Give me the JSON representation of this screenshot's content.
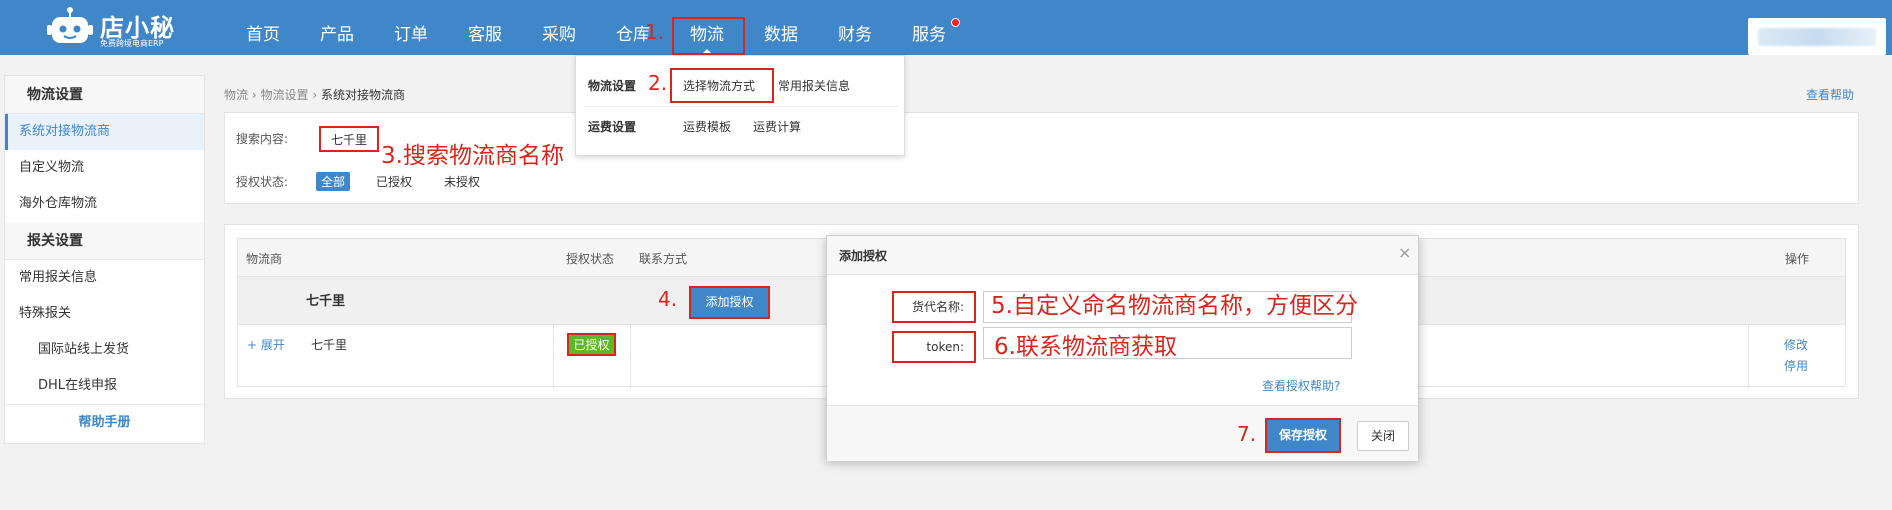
{
  "app": {
    "brand": "店小秘",
    "tagline": "免费跨境电商ERP"
  },
  "nav": {
    "items": [
      {
        "label": "首页"
      },
      {
        "label": "产品"
      },
      {
        "label": "订单"
      },
      {
        "label": "客服"
      },
      {
        "label": "采购"
      },
      {
        "label": "仓库"
      },
      {
        "label": "物流"
      },
      {
        "label": "数据"
      },
      {
        "label": "财务"
      },
      {
        "label": "服务"
      }
    ],
    "active_index": 6
  },
  "dropdown": {
    "group1": {
      "title": "物流设置",
      "links": [
        "选择物流方式",
        "常用报关信息"
      ]
    },
    "group2": {
      "title": "运费设置",
      "links": [
        "运费模板",
        "运费计算"
      ]
    }
  },
  "sidebar": {
    "group1": "物流设置",
    "items1": [
      "系统对接物流商",
      "自定义物流",
      "海外仓库物流"
    ],
    "group2": "报关设置",
    "items2": [
      "常用报关信息",
      "特殊报关"
    ],
    "subitems": [
      "国际站线上发货",
      "DHL在线申报"
    ],
    "help": "帮助手册"
  },
  "breadcrumb": {
    "a": "物流",
    "sep": "›",
    "b": "物流设置",
    "c": "系统对接物流商"
  },
  "help_link": "查看帮助",
  "search": {
    "label": "搜索内容:",
    "value": "七千里",
    "status_label": "授权状态:",
    "filters": [
      "全部",
      "已授权",
      "未授权"
    ]
  },
  "table": {
    "headers": [
      "物流商",
      "授权状态",
      "联系方式",
      "操作"
    ],
    "group_name": "七千里",
    "add_button": "添加授权",
    "expand": "+ 展开",
    "row_name": "七千里",
    "row_status": "已授权",
    "actions": [
      "修改",
      "停用"
    ]
  },
  "modal": {
    "title": "添加授权",
    "close": "×",
    "field1_label": "货代名称:",
    "field2_label": "token:",
    "help": "查看授权帮助?",
    "save": "保存授权",
    "cancel": "关闭"
  },
  "annotations": {
    "a1": "1.",
    "a2": "2.",
    "a3": "3.搜索物流商名称",
    "a4": "4.",
    "a5": "5.自定义命名物流商名称，方便区分",
    "a6": "6.联系物流商获取",
    "a7": "7."
  },
  "colors": {
    "primary": "#3f87c9",
    "annotation": "#d9261c",
    "success": "#5cb82a"
  }
}
